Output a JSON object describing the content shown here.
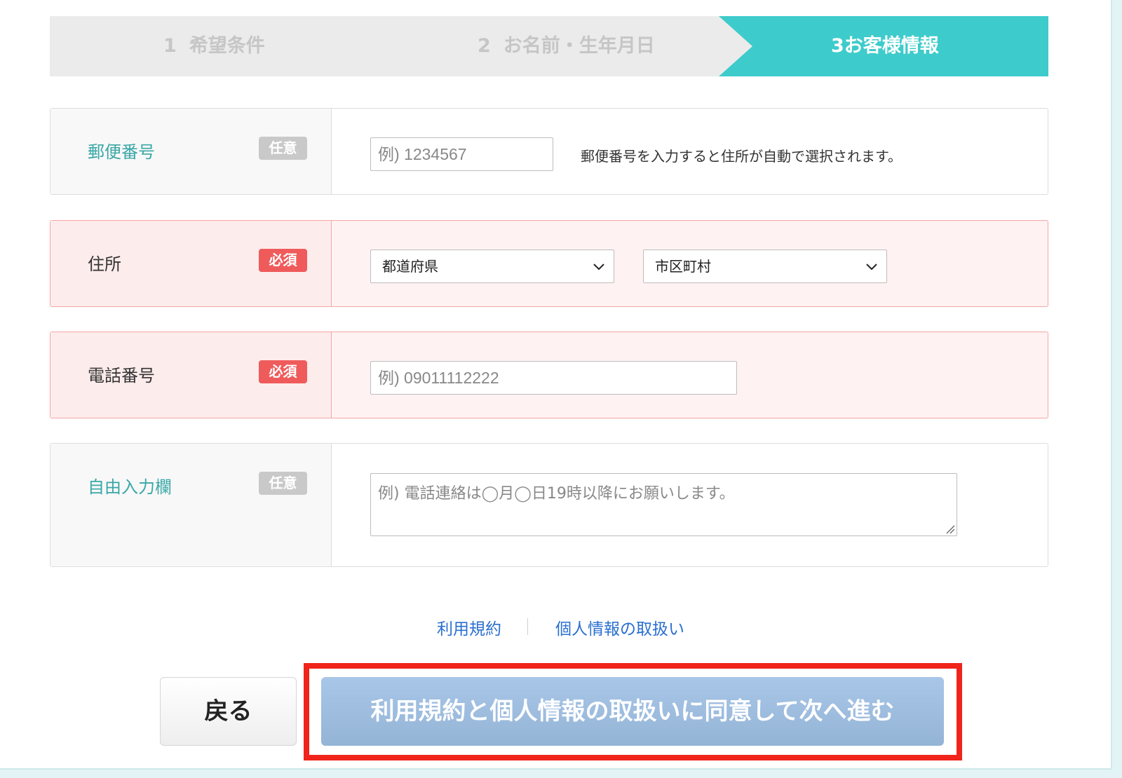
{
  "steps": [
    {
      "num": "1",
      "label": "希望条件"
    },
    {
      "num": "2",
      "label": "お名前・生年月日"
    },
    {
      "num": "3",
      "label": "お客様情報"
    }
  ],
  "colors": {
    "accent": "#3ecbcb",
    "required": "#ef5b5b",
    "link": "#2a6fd0",
    "highlight": "#f0241b"
  },
  "postal": {
    "label": "郵便番号",
    "badge": "任意",
    "placeholder": "例) 1234567",
    "help": "郵便番号を入力すると住所が自動で選択されます。"
  },
  "address": {
    "label": "住所",
    "badge": "必須",
    "prefecture": "都道府県",
    "city": "市区町村"
  },
  "phone": {
    "label": "電話番号",
    "badge": "必須",
    "placeholder": "例) 09011112222"
  },
  "free": {
    "label": "自由入力欄",
    "badge": "任意",
    "placeholder": "例) 電話連絡は◯月◯日19時以降にお願いします。"
  },
  "links": {
    "terms": "利用規約",
    "privacy": "個人情報の取扱い"
  },
  "buttons": {
    "back": "戻る",
    "next": "利用規約と個人情報の取扱いに同意して次へ進む"
  }
}
